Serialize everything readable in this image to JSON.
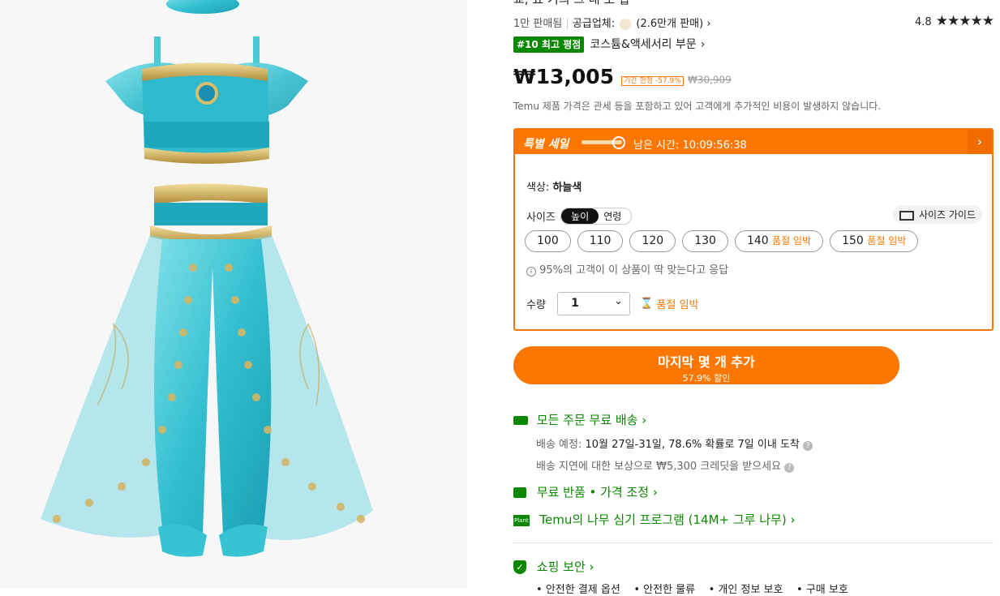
{
  "product": {
    "title_fragment": "교, 요 기의 그 래 로 합",
    "sales": "1만 판매됨",
    "supplier_label": "공급업체:",
    "supplier_sales": "(2.6만개 판매)",
    "rating": "4.8",
    "stars": "★★★★★",
    "rank_badge": "#10 최고 평점",
    "category_link": "코스튬&액세서리 부문",
    "price": "₩13,005",
    "deal_badge": "기간 한정 -57.9%",
    "original_price": "₩30,909",
    "tax_note": "Temu 제품 가격은 관세 등을 포함하고 있어 고객에게 추가적인 비용이 발생하지 않습니다."
  },
  "sale_box": {
    "label": "특별 세일",
    "timer_label": "남은 시간: 10:09:56:38",
    "color_label": "색상:",
    "color_value": "하늘색",
    "size_label": "사이즈",
    "size_tabs": [
      "높이",
      "연령"
    ],
    "size_guide": "사이즈 가이드",
    "sizes": [
      {
        "value": "100",
        "note": ""
      },
      {
        "value": "110",
        "note": ""
      },
      {
        "value": "120",
        "note": ""
      },
      {
        "value": "130",
        "note": ""
      },
      {
        "value": "140",
        "note": "품절 임박"
      },
      {
        "value": "150",
        "note": "품절 임박"
      }
    ],
    "fit_note": "95%의 고객이 이 상품이 딱 맞는다고 응답",
    "qty_label": "수량",
    "qty_value": "1",
    "stock_note": "품절 임박"
  },
  "cta": {
    "label": "마지막 몇 개 추가",
    "sub": "57.9% 할인"
  },
  "shipping": {
    "free_ship": "모든 주문 무료 배송",
    "eta_label": "배송 예정:",
    "eta_value": "10월 27일-31일, 78.6% 확률로 7일 이내 도착",
    "delay_note": "배송 지연에 대한 보상으로 ₩5,300 크레딧을 받으세요",
    "returns": "무료 반품 • 가격 조정",
    "tree": "Temu의 나무 심기 프로그램 (14M+ 그루 나무)",
    "tree_icon_text": "Plant",
    "security": "쇼핑 보안",
    "security_items": [
      "안전한 결제 옵션",
      "안전한 물류",
      "개인 정보 보호",
      "구매 보호"
    ]
  },
  "colors": {
    "orange": "#fb7701",
    "green": "#0a8800",
    "teal": "#39c4d3"
  }
}
